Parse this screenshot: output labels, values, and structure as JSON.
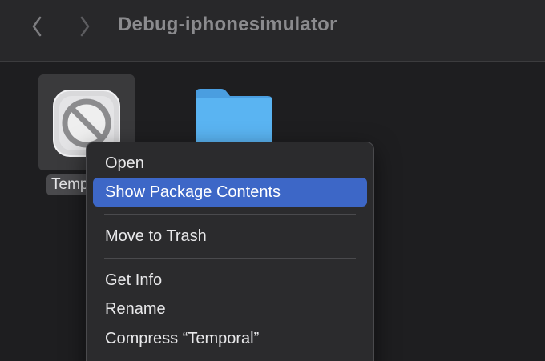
{
  "window": {
    "title": "Debug-iphonesimulator"
  },
  "toolbar": {
    "back_icon": "chevron-left-icon",
    "forward_icon": "chevron-right-icon"
  },
  "files": [
    {
      "label": "Temp",
      "icon": "app-prohibited-icon",
      "selected": true
    },
    {
      "label": "",
      "icon": "folder-icon",
      "selected": false
    }
  ],
  "context_menu": {
    "items": [
      {
        "label": "Open"
      },
      {
        "label": "Show Package Contents",
        "highlighted": true
      },
      {
        "label": "Move to Trash"
      },
      {
        "label": "Get Info"
      },
      {
        "label": "Rename"
      },
      {
        "label": "Compress “Temporal”"
      }
    ]
  },
  "colors": {
    "highlight": "#3d67c7",
    "folder": "#5ab4f2"
  }
}
